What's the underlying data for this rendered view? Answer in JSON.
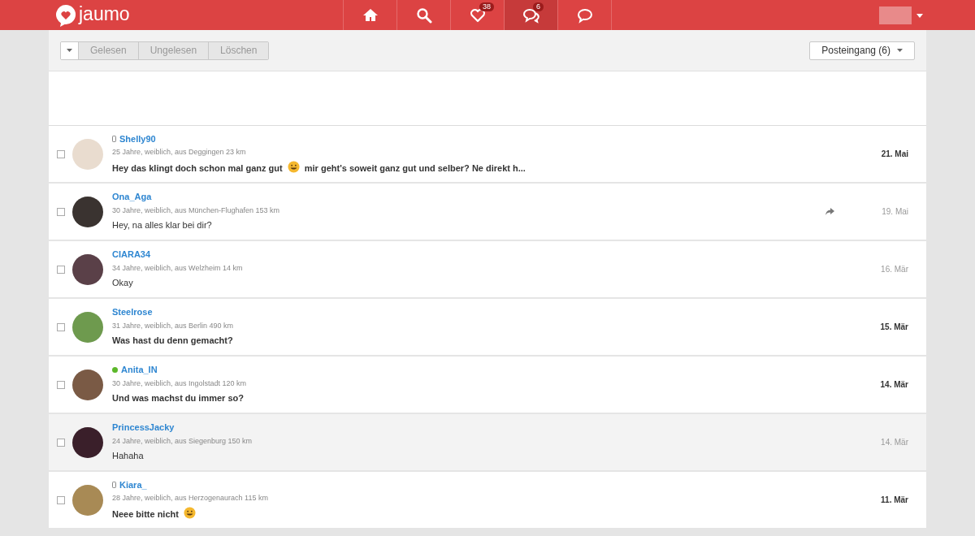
{
  "header": {
    "logo": "jaumo",
    "nav": [
      {
        "kind": "home",
        "selected": false
      },
      {
        "kind": "search",
        "selected": false
      },
      {
        "kind": "likes",
        "selected": false,
        "badge": "38"
      },
      {
        "kind": "chats",
        "selected": true,
        "badge": "6"
      },
      {
        "kind": "chat",
        "selected": false
      }
    ]
  },
  "toolbar": {
    "actions": [
      "Gelesen",
      "Ungelesen",
      "Löschen"
    ],
    "folder": "Posteingang (6)"
  },
  "messages": [
    {
      "name": "Shelly90",
      "mobile": true,
      "online": false,
      "info": "25 Jahre, weiblich, aus Deggingen 23 km",
      "unread": true,
      "replied": false,
      "highlighted": false,
      "checked": false,
      "date": "21. Mai",
      "text": [
        {
          "kind": "text",
          "value": "Hey das klingt doch schon mal ganz gut"
        },
        {
          "kind": "emoji"
        },
        {
          "kind": "text",
          "value": "mir geht's soweit ganz gut und selber? Ne direkt h..."
        }
      ]
    },
    {
      "name": "Ona_Aga",
      "mobile": false,
      "online": false,
      "info": "30 Jahre, weiblich, aus München-Flughafen 153 km",
      "unread": false,
      "replied": true,
      "highlighted": false,
      "checked": false,
      "date": "19. Mai",
      "text": [
        {
          "kind": "text",
          "value": "Hey, na alles klar bei dir?"
        }
      ]
    },
    {
      "name": "CIARA34",
      "mobile": false,
      "online": false,
      "info": "34 Jahre, weiblich, aus Welzheim 14 km",
      "unread": false,
      "replied": false,
      "highlighted": false,
      "checked": false,
      "date": "16. Mär",
      "text": [
        {
          "kind": "text",
          "value": "Okay"
        }
      ]
    },
    {
      "name": "Steelrose",
      "mobile": false,
      "online": false,
      "info": "31 Jahre, weiblich, aus Berlin 490 km",
      "unread": true,
      "replied": false,
      "highlighted": false,
      "checked": false,
      "date": "15. Mär",
      "text": [
        {
          "kind": "text",
          "value": "Was hast du denn gemacht?"
        }
      ]
    },
    {
      "name": "Anita_IN",
      "mobile": false,
      "online": true,
      "info": "30 Jahre, weiblich, aus Ingolstadt 120 km",
      "unread": true,
      "replied": false,
      "highlighted": false,
      "checked": false,
      "date": "14. Mär",
      "text": [
        {
          "kind": "text",
          "value": "Und was machst du immer so?"
        }
      ]
    },
    {
      "name": "PrincessJacky",
      "mobile": false,
      "online": false,
      "info": "24 Jahre, weiblich, aus Siegenburg 150 km",
      "unread": false,
      "replied": false,
      "highlighted": true,
      "checked": false,
      "date": "14. Mär",
      "text": [
        {
          "kind": "text",
          "value": "Hahaha"
        }
      ]
    },
    {
      "name": "Kiara_",
      "mobile": true,
      "online": false,
      "info": "28 Jahre, weiblich, aus Herzogenaurach 115 km",
      "unread": true,
      "replied": false,
      "highlighted": false,
      "checked": false,
      "date": "11. Mär",
      "text": [
        {
          "kind": "text",
          "value": "Neee bitte nicht"
        },
        {
          "kind": "emoji"
        }
      ]
    }
  ]
}
